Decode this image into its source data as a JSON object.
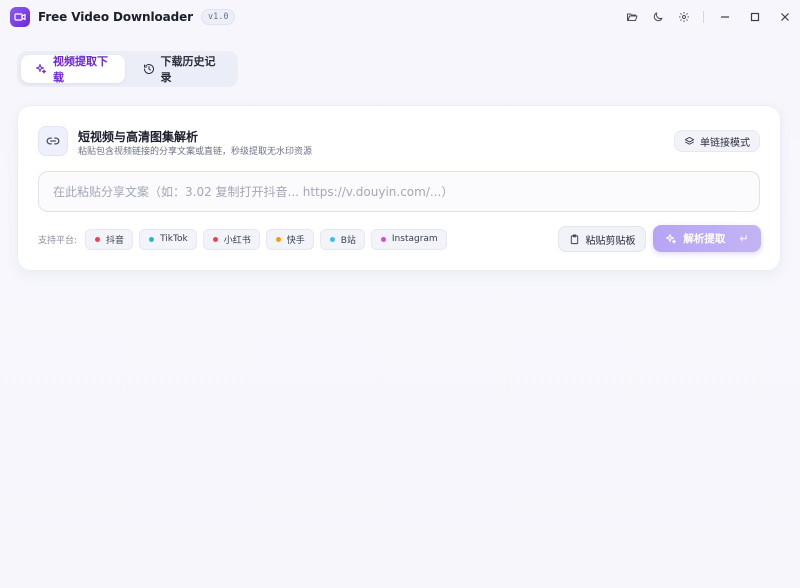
{
  "window": {
    "title": "Free Video Downloader",
    "version": "v1.0"
  },
  "tabs": [
    {
      "label": "视频提取下载",
      "active": true
    },
    {
      "label": "下载历史记录",
      "active": false
    }
  ],
  "card": {
    "title": "短视频与高清图集解析",
    "subtitle": "粘贴包含视频链接的分享文案或直链，秒级提取无水印资源",
    "mode_button": "单链接模式",
    "input_placeholder": "在此粘贴分享文案（如：3.02 复制打开抖音... https://v.douyin.com/...）",
    "input_value": "",
    "platforms_label": "支持平台:",
    "platforms": [
      {
        "name": "抖音",
        "color": "#ef4444"
      },
      {
        "name": "TikTok",
        "color": "#22b8cf"
      },
      {
        "name": "小红书",
        "color": "#ef4444"
      },
      {
        "name": "快手",
        "color": "#f59e0b"
      },
      {
        "name": "B站",
        "color": "#38bdf8"
      },
      {
        "name": "Instagram",
        "color": "#d946ef"
      }
    ],
    "paste_button": "粘贴剪贴板",
    "parse_button": "解析提取",
    "parse_hint": "↵"
  },
  "colors": {
    "accent": "#6d28d9",
    "accent_light": "#b7a4f6"
  }
}
